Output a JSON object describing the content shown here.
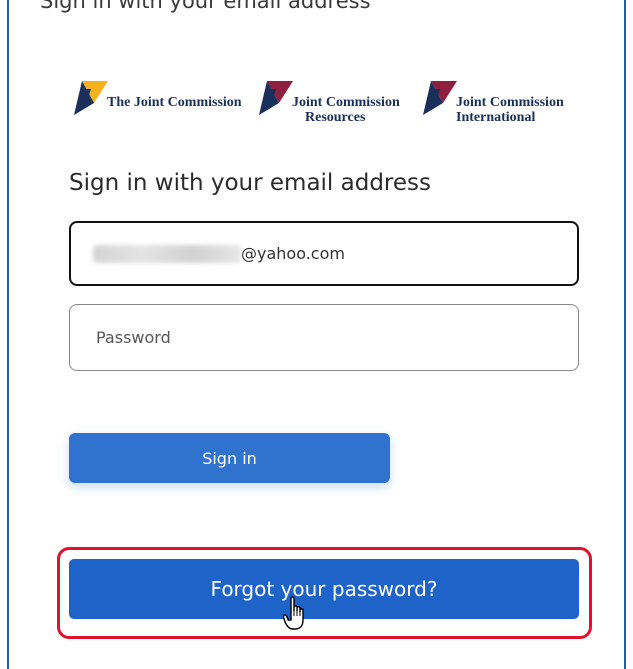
{
  "header": {
    "partial_text": "Sign in with your email address"
  },
  "logos": [
    {
      "lines": [
        "The Joint Commission"
      ],
      "accent": "#f4b31d"
    },
    {
      "lines": [
        "Joint Commission",
        "Resources"
      ],
      "accent": "#8e1f3e"
    },
    {
      "lines": [
        "Joint Commission",
        "International"
      ],
      "accent": "#8e1f3e"
    }
  ],
  "form": {
    "heading": "Sign in with your email address",
    "email": {
      "value_visible": "@yahoo.com",
      "value_redacted": true
    },
    "password": {
      "placeholder": "Password"
    },
    "signin_label": "Sign in",
    "forgot_label": "Forgot your password?"
  },
  "colors": {
    "frame": "#1f5fa8",
    "primary_button": "#2f73cf",
    "forgot_button": "#1d63c8",
    "highlight": "#e0112b",
    "logo_navy": "#1b2f5b"
  },
  "icons": [
    "jc-logo-mark-icon",
    "jcr-logo-mark-icon",
    "jci-logo-mark-icon",
    "hand-pointer-cursor-icon"
  ]
}
